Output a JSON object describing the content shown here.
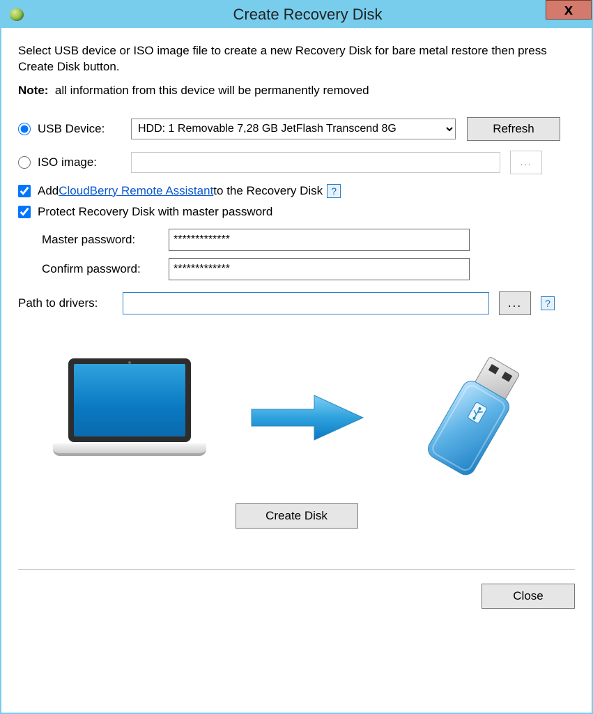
{
  "window": {
    "title": "Create Recovery Disk",
    "close_glyph": "x"
  },
  "intro": "Select USB device or ISO image file to create a new Recovery Disk for bare metal restore then press Create Disk button.",
  "note_label": "Note:",
  "note_text": "all information from this device will be permanently removed",
  "device": {
    "usb_radio_label": "USB Device:",
    "iso_radio_label": "ISO image:",
    "selected": "HDD: 1 Removable 7,28 GB JetFlash Transcend 8G",
    "refresh_label": "Refresh",
    "iso_value": "",
    "browse_glyph": "..."
  },
  "add_assistant": {
    "prefix": "Add ",
    "link": "CloudBerry Remote Assistant",
    "suffix": " to the Recovery Disk",
    "help_glyph": "?"
  },
  "protect": {
    "label": "Protect Recovery Disk with master password",
    "master_label": "Master password:",
    "confirm_label": "Confirm password:",
    "master_value": "*************",
    "confirm_value": "*************"
  },
  "drivers": {
    "label": "Path to drivers:",
    "value": "",
    "browse_glyph": "...",
    "help_glyph": "?"
  },
  "buttons": {
    "create": "Create Disk",
    "close": "Close"
  }
}
